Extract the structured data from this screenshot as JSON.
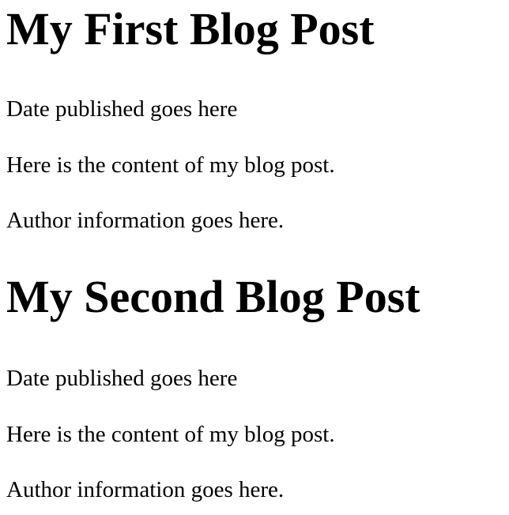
{
  "posts": [
    {
      "title": "My First Blog Post",
      "date": "Date published goes here",
      "content": "Here is the content of my blog post.",
      "author": "Author information goes here."
    },
    {
      "title": "My Second Blog Post",
      "date": "Date published goes here",
      "content": "Here is the content of my blog post.",
      "author": "Author information goes here."
    }
  ]
}
